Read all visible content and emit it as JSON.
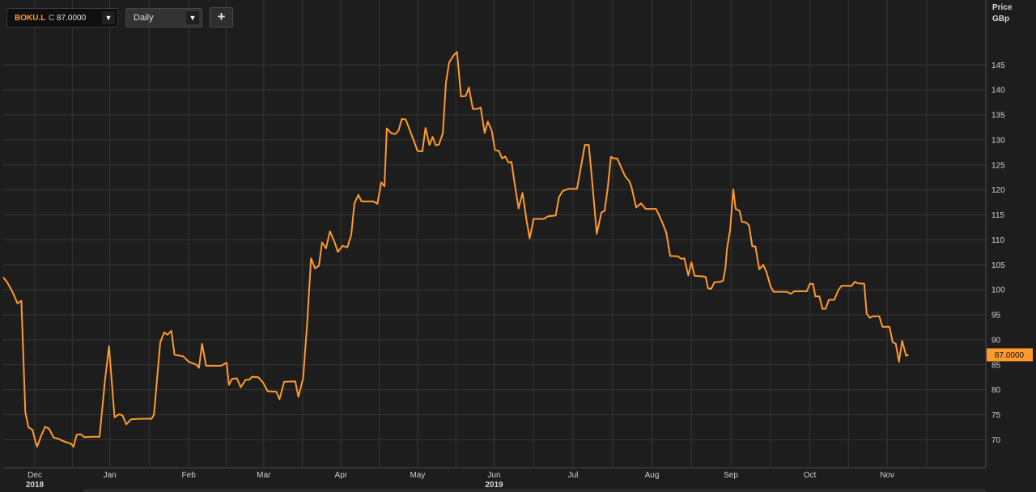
{
  "toolbar": {
    "symbol": "BOKU.L",
    "close_prefix": "C",
    "close_value": "87.0000",
    "dropdown_arrow": "▼",
    "interval": "Daily",
    "add_label": "+"
  },
  "axis_title": {
    "line1": "Price",
    "line2": "GBp"
  },
  "colors": {
    "line": "#ff9a2e",
    "background": "#1d1d1d",
    "grid": "#363636",
    "last_badge": "#ff9a2e"
  },
  "chart_data": {
    "type": "line",
    "title": "",
    "xlabel": "",
    "ylabel": "Price GBp",
    "grid": true,
    "ylim": [
      64.4,
      158
    ],
    "yticks": [
      70,
      75,
      80,
      85,
      90,
      95,
      100,
      105,
      110,
      115,
      120,
      125,
      130,
      135,
      140,
      145
    ],
    "x_ticks": [
      {
        "label": "Dec",
        "x": 0.4
      },
      {
        "label": "Jan",
        "x": 1.35
      },
      {
        "label": "Feb",
        "x": 2.35
      },
      {
        "label": "Mar",
        "x": 3.3
      },
      {
        "label": "Apr",
        "x": 4.28
      },
      {
        "label": "May",
        "x": 5.25
      },
      {
        "label": "Jun",
        "x": 6.22
      },
      {
        "label": "Jul",
        "x": 7.22
      },
      {
        "label": "Aug",
        "x": 8.22
      },
      {
        "label": "Sep",
        "x": 9.22
      },
      {
        "label": "Oct",
        "x": 10.22
      },
      {
        "label": "Nov",
        "x": 11.2
      }
    ],
    "years": [
      {
        "label": "2018",
        "x": 0.4
      },
      {
        "label": "2019",
        "x": 6.22
      }
    ],
    "x_range": [
      0,
      12.45
    ],
    "last_value": "87.0000",
    "series": [
      {
        "color": "#ff9a2e",
        "points": [
          [
            0.0,
            102.5
          ],
          [
            0.05,
            101.5
          ],
          [
            0.12,
            99.5
          ],
          [
            0.18,
            97.3
          ],
          [
            0.23,
            97.8
          ],
          [
            0.28,
            75.5
          ],
          [
            0.32,
            72.5
          ],
          [
            0.37,
            72.0
          ],
          [
            0.41,
            69.5
          ],
          [
            0.43,
            68.6
          ],
          [
            0.48,
            70.8
          ],
          [
            0.53,
            72.6
          ],
          [
            0.58,
            72.2
          ],
          [
            0.64,
            70.4
          ],
          [
            0.7,
            70.2
          ],
          [
            0.75,
            69.8
          ],
          [
            0.8,
            69.5
          ],
          [
            0.86,
            69.2
          ],
          [
            0.89,
            68.6
          ],
          [
            0.93,
            71.0
          ],
          [
            0.98,
            71.1
          ],
          [
            1.03,
            70.5
          ],
          [
            1.12,
            70.6
          ],
          [
            1.22,
            70.6
          ],
          [
            1.29,
            82.0
          ],
          [
            1.34,
            88.7
          ],
          [
            1.41,
            74.5
          ],
          [
            1.47,
            75.1
          ],
          [
            1.51,
            74.9
          ],
          [
            1.56,
            73.1
          ],
          [
            1.62,
            74.1
          ],
          [
            1.75,
            74.2
          ],
          [
            1.88,
            74.2
          ],
          [
            1.91,
            75.0
          ],
          [
            1.99,
            89.5
          ],
          [
            2.04,
            91.5
          ],
          [
            2.08,
            91.0
          ],
          [
            2.13,
            91.8
          ],
          [
            2.17,
            87.0
          ],
          [
            2.28,
            86.7
          ],
          [
            2.35,
            85.6
          ],
          [
            2.45,
            85.0
          ],
          [
            2.48,
            84.4
          ],
          [
            2.52,
            89.2
          ],
          [
            2.57,
            84.8
          ],
          [
            2.67,
            84.8
          ],
          [
            2.76,
            84.8
          ],
          [
            2.83,
            85.4
          ],
          [
            2.86,
            81.0
          ],
          [
            2.9,
            82.2
          ],
          [
            2.96,
            82.3
          ],
          [
            3.01,
            80.5
          ],
          [
            3.07,
            82.0
          ],
          [
            3.12,
            82.0
          ],
          [
            3.15,
            82.6
          ],
          [
            3.23,
            82.5
          ],
          [
            3.29,
            81.5
          ],
          [
            3.35,
            79.7
          ],
          [
            3.46,
            79.6
          ],
          [
            3.5,
            78.1
          ],
          [
            3.56,
            81.6
          ],
          [
            3.7,
            81.7
          ],
          [
            3.74,
            78.6
          ],
          [
            3.8,
            82.3
          ],
          [
            3.85,
            93.0
          ],
          [
            3.9,
            106.3
          ],
          [
            3.95,
            104.3
          ],
          [
            4.0,
            104.8
          ],
          [
            4.04,
            109.5
          ],
          [
            4.09,
            108.3
          ],
          [
            4.14,
            111.7
          ],
          [
            4.2,
            109.5
          ],
          [
            4.24,
            107.6
          ],
          [
            4.3,
            108.8
          ],
          [
            4.36,
            108.5
          ],
          [
            4.41,
            111.0
          ],
          [
            4.45,
            117.3
          ],
          [
            4.5,
            119.0
          ],
          [
            4.54,
            117.7
          ],
          [
            4.69,
            117.7
          ],
          [
            4.74,
            117.2
          ],
          [
            4.79,
            121.5
          ],
          [
            4.83,
            120.7
          ],
          [
            4.86,
            132.3
          ],
          [
            4.92,
            131.3
          ],
          [
            4.97,
            131.2
          ],
          [
            5.01,
            131.9
          ],
          [
            5.05,
            134.2
          ],
          [
            5.1,
            134.1
          ],
          [
            5.15,
            132.0
          ],
          [
            5.21,
            129.5
          ],
          [
            5.25,
            127.8
          ],
          [
            5.31,
            127.7
          ],
          [
            5.35,
            132.4
          ],
          [
            5.4,
            129.0
          ],
          [
            5.44,
            130.6
          ],
          [
            5.48,
            128.9
          ],
          [
            5.52,
            129.1
          ],
          [
            5.57,
            131.3
          ],
          [
            5.61,
            141.5
          ],
          [
            5.65,
            145.5
          ],
          [
            5.71,
            147.0
          ],
          [
            5.75,
            147.6
          ],
          [
            5.8,
            138.7
          ],
          [
            5.86,
            138.8
          ],
          [
            5.9,
            140.5
          ],
          [
            5.95,
            136.2
          ],
          [
            6.01,
            136.2
          ],
          [
            6.05,
            136.5
          ],
          [
            6.1,
            131.4
          ],
          [
            6.14,
            133.7
          ],
          [
            6.19,
            131.8
          ],
          [
            6.23,
            128.0
          ],
          [
            6.28,
            127.8
          ],
          [
            6.32,
            126.3
          ],
          [
            6.36,
            126.7
          ],
          [
            6.4,
            125.5
          ],
          [
            6.44,
            125.6
          ],
          [
            6.48,
            121.2
          ],
          [
            6.53,
            116.3
          ],
          [
            6.58,
            119.4
          ],
          [
            6.63,
            114.0
          ],
          [
            6.67,
            110.3
          ],
          [
            6.72,
            114.2
          ],
          [
            6.85,
            114.2
          ],
          [
            6.9,
            114.7
          ],
          [
            7.0,
            114.9
          ],
          [
            7.04,
            118.5
          ],
          [
            7.09,
            119.8
          ],
          [
            7.16,
            120.2
          ],
          [
            7.27,
            120.2
          ],
          [
            7.37,
            129.0
          ],
          [
            7.42,
            129.0
          ],
          [
            7.47,
            120.3
          ],
          [
            7.52,
            111.2
          ],
          [
            7.58,
            115.5
          ],
          [
            7.62,
            115.8
          ],
          [
            7.66,
            120.4
          ],
          [
            7.7,
            126.6
          ],
          [
            7.74,
            126.3
          ],
          [
            7.78,
            126.3
          ],
          [
            7.83,
            124.5
          ],
          [
            7.88,
            122.7
          ],
          [
            7.93,
            121.8
          ],
          [
            7.96,
            120.6
          ],
          [
            8.02,
            116.5
          ],
          [
            8.08,
            117.3
          ],
          [
            8.14,
            116.2
          ],
          [
            8.27,
            116.2
          ],
          [
            8.3,
            115.3
          ],
          [
            8.35,
            113.5
          ],
          [
            8.4,
            111.5
          ],
          [
            8.45,
            106.8
          ],
          [
            8.55,
            106.7
          ],
          [
            8.59,
            106.2
          ],
          [
            8.63,
            106.3
          ],
          [
            8.68,
            102.9
          ],
          [
            8.72,
            105.5
          ],
          [
            8.76,
            102.8
          ],
          [
            8.86,
            102.7
          ],
          [
            8.9,
            102.6
          ],
          [
            8.93,
            100.3
          ],
          [
            8.97,
            100.2
          ],
          [
            9.01,
            101.5
          ],
          [
            9.08,
            101.6
          ],
          [
            9.12,
            101.8
          ],
          [
            9.15,
            104.2
          ],
          [
            9.17,
            108.2
          ],
          [
            9.21,
            112.0
          ],
          [
            9.25,
            120.1
          ],
          [
            9.28,
            116.2
          ],
          [
            9.33,
            115.8
          ],
          [
            9.36,
            113.6
          ],
          [
            9.41,
            113.5
          ],
          [
            9.45,
            112.9
          ],
          [
            9.49,
            108.7
          ],
          [
            9.53,
            108.7
          ],
          [
            9.58,
            104.1
          ],
          [
            9.63,
            105.0
          ],
          [
            9.67,
            103.6
          ],
          [
            9.72,
            100.8
          ],
          [
            9.76,
            99.6
          ],
          [
            9.93,
            99.6
          ],
          [
            9.98,
            99.2
          ],
          [
            10.02,
            99.7
          ],
          [
            10.1,
            99.7
          ],
          [
            10.18,
            99.7
          ],
          [
            10.22,
            101.2
          ],
          [
            10.26,
            101.2
          ],
          [
            10.29,
            98.7
          ],
          [
            10.34,
            98.7
          ],
          [
            10.38,
            96.2
          ],
          [
            10.42,
            96.2
          ],
          [
            10.46,
            98.0
          ],
          [
            10.53,
            98.0
          ],
          [
            10.58,
            99.9
          ],
          [
            10.62,
            100.8
          ],
          [
            10.71,
            100.8
          ],
          [
            10.75,
            100.8
          ],
          [
            10.79,
            101.6
          ],
          [
            10.83,
            101.3
          ],
          [
            10.91,
            101.2
          ],
          [
            10.94,
            95.2
          ],
          [
            10.98,
            94.4
          ],
          [
            11.02,
            94.7
          ],
          [
            11.1,
            94.7
          ],
          [
            11.14,
            92.6
          ],
          [
            11.23,
            92.6
          ],
          [
            11.27,
            89.5
          ],
          [
            11.31,
            89.2
          ],
          [
            11.35,
            85.6
          ],
          [
            11.39,
            89.8
          ],
          [
            11.44,
            86.8
          ],
          [
            11.47,
            87.0
          ]
        ]
      }
    ]
  }
}
